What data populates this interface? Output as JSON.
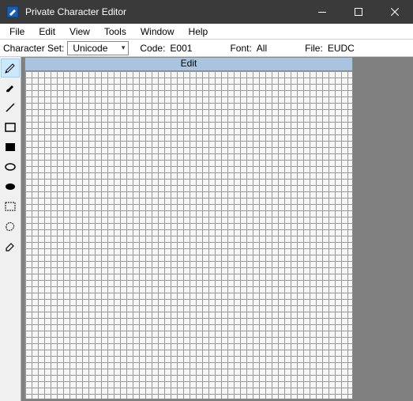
{
  "window": {
    "title": "Private Character Editor"
  },
  "menubar": {
    "file": "File",
    "edit": "Edit",
    "view": "View",
    "tools": "Tools",
    "window": "Window",
    "help": "Help"
  },
  "info": {
    "charset_label": "Character Set:",
    "charset_value": "Unicode",
    "code_label": "Code:",
    "code_value": "E001",
    "font_label": "Font:",
    "font_value": "All",
    "file_label": "File:",
    "file_value": "EUDC"
  },
  "canvas": {
    "header": "Edit"
  },
  "tools": [
    {
      "id": "pencil",
      "name": "pencil-icon"
    },
    {
      "id": "brush",
      "name": "brush-icon"
    },
    {
      "id": "line",
      "name": "line-icon"
    },
    {
      "id": "rect",
      "name": "rectangle-outline-icon"
    },
    {
      "id": "rect-fill",
      "name": "rectangle-filled-icon"
    },
    {
      "id": "ellipse",
      "name": "ellipse-outline-icon"
    },
    {
      "id": "ellipse-fill",
      "name": "ellipse-filled-icon"
    },
    {
      "id": "select",
      "name": "rectangular-select-icon"
    },
    {
      "id": "free-select",
      "name": "freeform-select-icon"
    },
    {
      "id": "eraser",
      "name": "eraser-icon"
    }
  ]
}
